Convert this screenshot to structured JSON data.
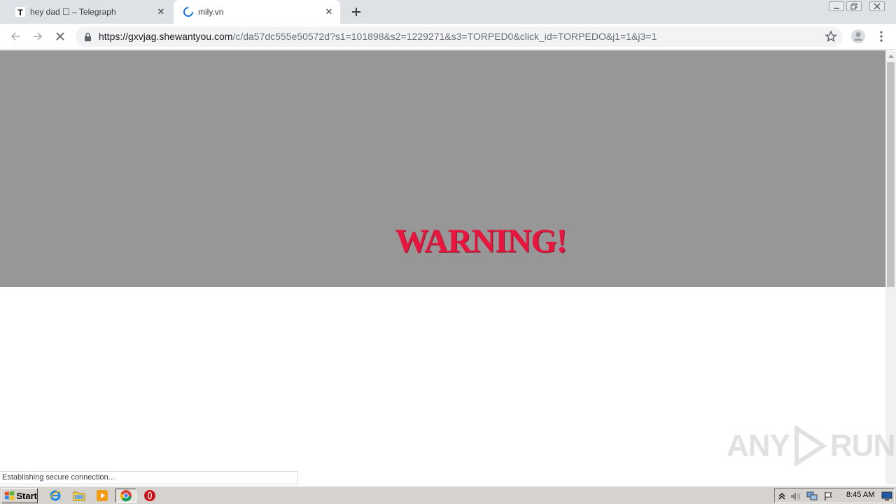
{
  "browser": {
    "tabs": [
      {
        "title": "hey dad ☐ – Telegraph",
        "favicon": "telegraph-t-icon"
      },
      {
        "title": "mily.vn",
        "favicon": "loading-spinner-icon",
        "active": true
      }
    ],
    "new_tab_icon": "plus-icon",
    "window_controls": [
      "minimize-icon",
      "restore-icon",
      "close-icon"
    ]
  },
  "toolbar": {
    "back_icon": "arrow-left-icon",
    "forward_icon": "arrow-right-icon",
    "stop_icon": "close-icon",
    "url_host": "https://gxvjag.shewantyou.com",
    "url_rest": "/c/da57dc555e50572d?s1=101898&s2=1229271&s3=TORPED0&click_id=TORPEDO&j1=1&j3=1",
    "bookmark_icon": "star-icon",
    "profile_icon": "avatar-icon",
    "menu_icon": "kebab-menu-icon"
  },
  "page": {
    "warning": "WARNING!",
    "background_color": "#979797",
    "warning_color": "#e8163f"
  },
  "status_bar": {
    "text": "Establishing secure connection..."
  },
  "watermark": {
    "left": "ANY",
    "right": "RUN"
  },
  "taskbar": {
    "start_label": "Start",
    "pinned": [
      "internet-explorer-icon",
      "folder-icon",
      "media-player-icon",
      "chrome-icon",
      "opera-icon"
    ],
    "tray_icons": [
      "chevron-up-icon",
      "speaker-icon",
      "network-icon",
      "flag-icon",
      "monitor-icon"
    ],
    "clock": "8:45 AM"
  }
}
